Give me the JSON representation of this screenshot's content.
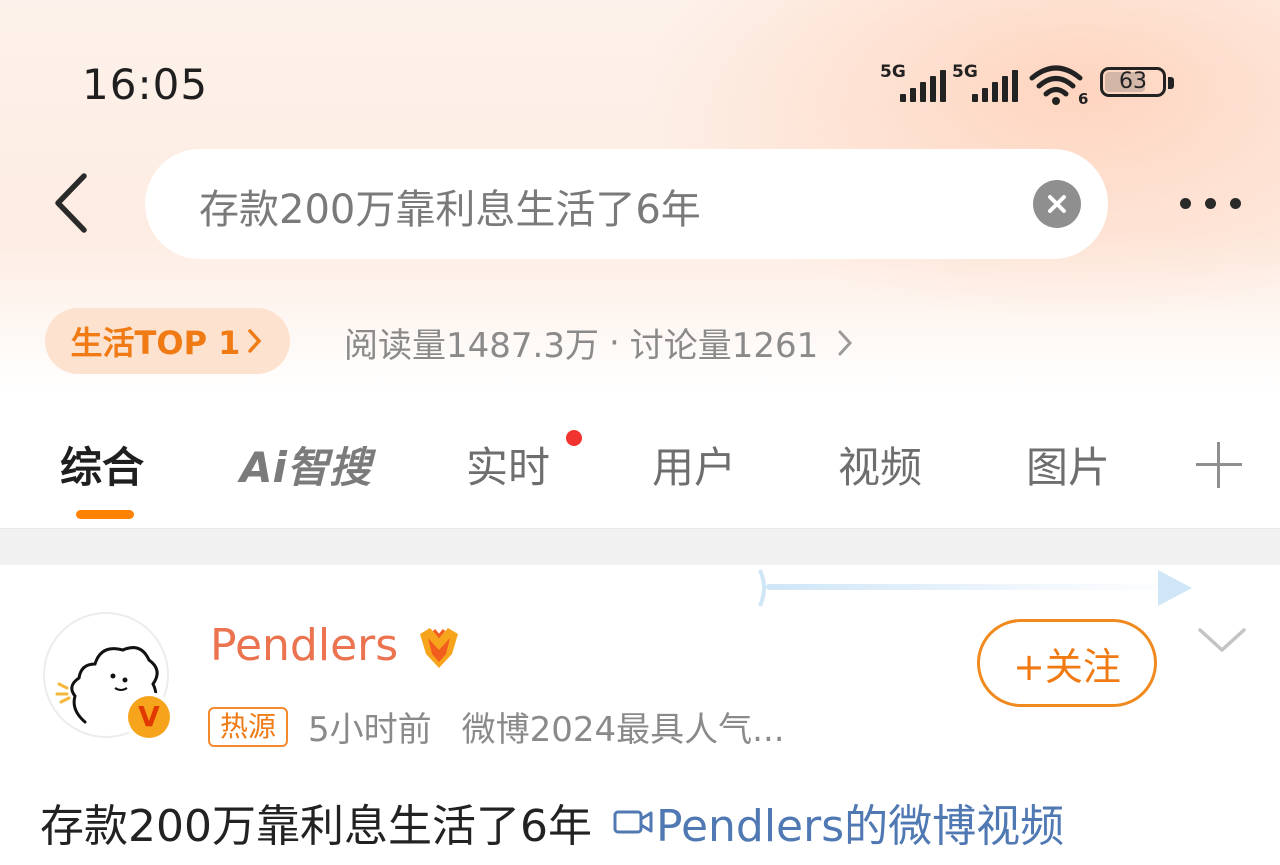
{
  "status_bar": {
    "time": "16:05",
    "signal1_label": "5G",
    "signal2_label": "5G",
    "wifi_label": "6",
    "battery": "63"
  },
  "search": {
    "query": "存款200万靠利息生活了6年"
  },
  "rank": {
    "label": "生活TOP 1",
    "reads": "阅读量1487.3万",
    "separator": "·",
    "discussions": "讨论量1261"
  },
  "tabs": [
    {
      "label": "综合"
    },
    {
      "label": "Ai智搜"
    },
    {
      "label": "实时"
    },
    {
      "label": "用户"
    },
    {
      "label": "视频"
    },
    {
      "label": "图片"
    }
  ],
  "post": {
    "username": "Pendlers",
    "verified_badge": "V",
    "tag": "热源",
    "time": "5小时前",
    "source": "微博2024最具人气...",
    "follow_label": "+关注",
    "text": "存款200万靠利息生活了6年",
    "video_link": "Pendlers的微博视频"
  },
  "colors": {
    "accent": "#ff8200",
    "username": "#eb7350",
    "link": "#5079b4",
    "red_dot": "#f0332e"
  },
  "icons": [
    "back-arrow-icon",
    "clear-icon",
    "more-icon",
    "chevron-right-icon",
    "plus-icon",
    "medal-icon",
    "chevron-down-icon",
    "video-camera-icon",
    "wifi-icon",
    "signal-icon",
    "battery-icon"
  ]
}
